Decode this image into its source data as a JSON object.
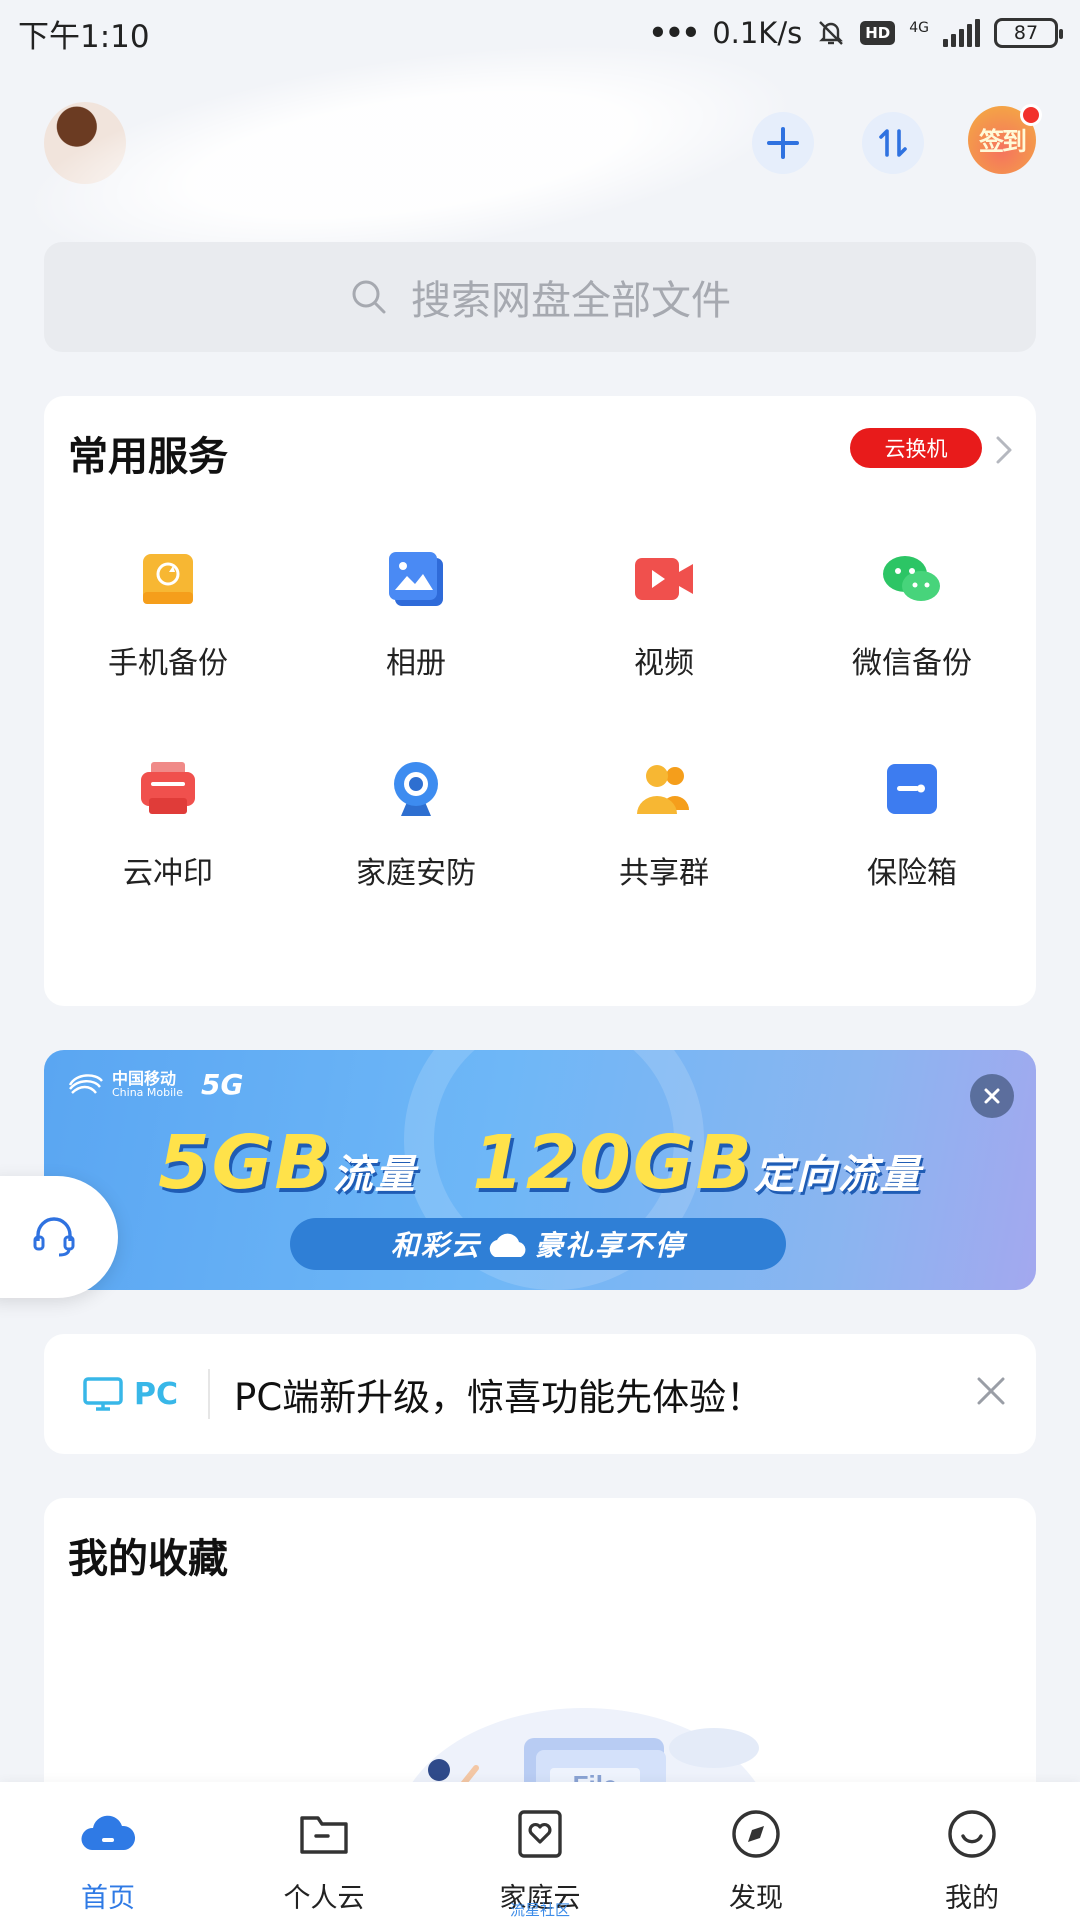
{
  "status_bar": {
    "time": "下午1:10",
    "network_speed": "0.1K/s",
    "hd": "HD",
    "network_type": "4G",
    "battery": "87"
  },
  "header": {
    "signin_label": "签到"
  },
  "search": {
    "placeholder": "搜索网盘全部文件"
  },
  "services": {
    "title": "常用服务",
    "promo_badge": "云换机",
    "items": [
      {
        "label": "手机备份",
        "icon": "phone-backup-icon",
        "color": "#f7b733"
      },
      {
        "label": "相册",
        "icon": "album-icon",
        "color": "#3d7cf0"
      },
      {
        "label": "视频",
        "icon": "video-icon",
        "color": "#f0504d"
      },
      {
        "label": "微信备份",
        "icon": "wechat-icon",
        "color": "#2cc565"
      },
      {
        "label": "云冲印",
        "icon": "printer-icon",
        "color": "#f0504d"
      },
      {
        "label": "家庭安防",
        "icon": "camera-icon",
        "color": "#3d8cf0"
      },
      {
        "label": "共享群",
        "icon": "group-icon",
        "color": "#f7b733"
      },
      {
        "label": "保险箱",
        "icon": "safe-icon",
        "color": "#3d7cf0"
      }
    ]
  },
  "banner": {
    "brand": "中国移动",
    "brand_en": "China Mobile",
    "network": "5G",
    "headline_part1": "5GB",
    "headline_unit1": "流量",
    "headline_part2": "120GB",
    "headline_unit2": "定向流量",
    "pill_left": "和彩云",
    "pill_right": "豪礼享不停"
  },
  "notice": {
    "badge": "PC",
    "text": "PC端新升级，惊喜功能先体验！"
  },
  "favorites": {
    "title": "我的收藏",
    "illustration_label": "File"
  },
  "bottom_nav": {
    "items": [
      {
        "label": "首页",
        "active": true
      },
      {
        "label": "个人云",
        "active": false
      },
      {
        "label": "家庭云",
        "active": false,
        "sub": "流星社区"
      },
      {
        "label": "发现",
        "active": false
      },
      {
        "label": "我的",
        "active": false
      }
    ]
  },
  "colors": {
    "accent": "#2f7ae5",
    "background": "#f2f4f8",
    "promo_red": "#e81b1b"
  }
}
